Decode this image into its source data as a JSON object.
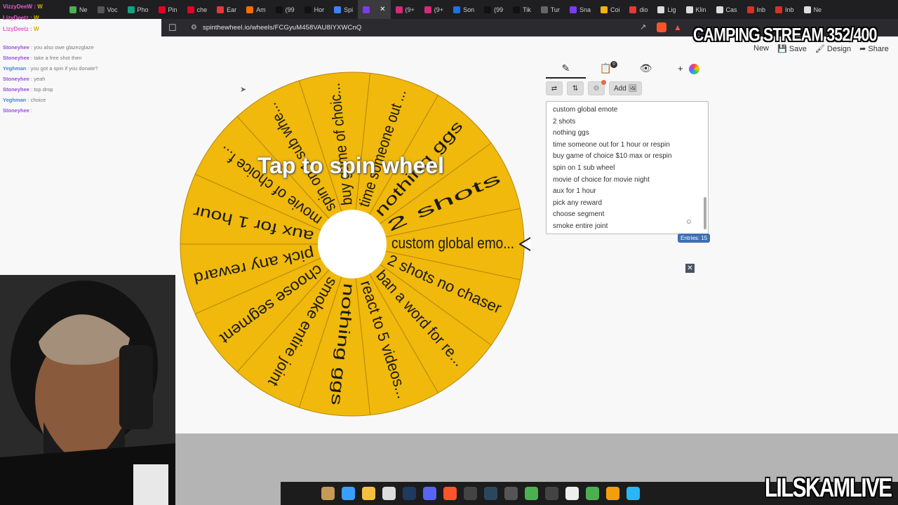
{
  "tabs": [
    {
      "label": "Ne",
      "color": "#4caf50"
    },
    {
      "label": "Voc",
      "color": "#555"
    },
    {
      "label": "Pho",
      "color": "#10a37f"
    },
    {
      "label": "Pin",
      "color": "#e60023"
    },
    {
      "label": "che",
      "color": "#e60023"
    },
    {
      "label": "Ear",
      "color": "#e53935"
    },
    {
      "label": "Am",
      "color": "#ff6d00"
    },
    {
      "label": "(99",
      "color": "#111"
    },
    {
      "label": "Hor",
      "color": "#111"
    },
    {
      "label": "Spi",
      "color": "#3b82f6"
    },
    {
      "label": "",
      "color": "#7c3aed",
      "active": true
    },
    {
      "label": "(9+",
      "color": "#d62976"
    },
    {
      "label": "(9+",
      "color": "#d62976"
    },
    {
      "label": "Son",
      "color": "#1a73e8"
    },
    {
      "label": "(99",
      "color": "#111"
    },
    {
      "label": "Tik",
      "color": "#111"
    },
    {
      "label": "Tur",
      "color": "#666"
    },
    {
      "label": "Sna",
      "color": "#7c3aed"
    },
    {
      "label": "Coi",
      "color": "#f5b400"
    },
    {
      "label": "dio",
      "color": "#e53935"
    },
    {
      "label": "Lig",
      "color": "#ddd"
    },
    {
      "label": "Klin",
      "color": "#ddd"
    },
    {
      "label": "Cas",
      "color": "#ddd"
    },
    {
      "label": "Inb",
      "color": "#d93025"
    },
    {
      "label": "Inb",
      "color": "#d93025"
    },
    {
      "label": "Ne",
      "color": "#ddd"
    }
  ],
  "address": {
    "url": "spinthewheel.io/wheels/FCGyuM458VAU8IYXWCnQ"
  },
  "chat_top": [
    {
      "user": "VizzyDeeW",
      "badge": "W"
    },
    {
      "user": "LizyDeetz",
      "badge": "W"
    },
    {
      "user": "LizyDeetz",
      "badge": "W"
    }
  ],
  "chat": [
    {
      "user": "Stoneyhee",
      "text": ": you also owe glazezglaze",
      "cls": "u1"
    },
    {
      "user": "Stoneyhee",
      "text": ": take a free shot then",
      "cls": "u1"
    },
    {
      "user": "Yeghman",
      "text": ": you got a spin if you donate?",
      "cls": "u2"
    },
    {
      "user": "Stoneyhee",
      "text": ": yeah",
      "cls": "u1"
    },
    {
      "user": "Stoneyhee",
      "text": ": top drop",
      "cls": "u1"
    },
    {
      "user": "Yeghman",
      "text": ": choice",
      "cls": "u2"
    },
    {
      "user": "Stoneyhee",
      "text": ":",
      "cls": "u1"
    }
  ],
  "overlay": {
    "camping": "CAMPING STREAM 352/400",
    "channel": "LILSKAMLIVE"
  },
  "topnav": {
    "new": "New",
    "save": "Save",
    "design": "Design",
    "share": "Share"
  },
  "wheel": {
    "spin_prompt": "Tap to spin wheel",
    "color": "#f0b90b",
    "segments": [
      "custom global emo...",
      "2 shots no chaser",
      "ban a word for re...",
      "react to 5 videos...",
      "nothing ggs",
      "smoke entire joint",
      "choose segment",
      "pick any reward",
      "aux for 1 hour",
      "movie of choice f...",
      "spin on 1 sub whe...",
      "buy game of choic...",
      "time someone out ...",
      "nothing ggs",
      "2 shots"
    ]
  },
  "panel": {
    "settings_badge": "!",
    "add_label": "Add",
    "entries": [
      "custom global emote",
      "2 shots",
      "nothing ggs",
      "time someone out for 1 hour or respin",
      "buy game of choice $10 max or respin",
      "spin on 1 sub wheel",
      "movie of choice for movie night",
      "aux for 1 hour",
      "pick any reward",
      "choose segment",
      "smoke entire joint"
    ],
    "entries_count": "Entries: 15"
  },
  "taskbar": [
    {
      "name": "cat-app",
      "color": "#c59a57"
    },
    {
      "name": "copilot",
      "color": "#3aa0ff"
    },
    {
      "name": "file-explorer",
      "color": "#f5c042"
    },
    {
      "name": "calculator",
      "color": "#ddd"
    },
    {
      "name": "photoshop",
      "color": "#1f3a5f"
    },
    {
      "name": "discord",
      "color": "#5865f2"
    },
    {
      "name": "brave",
      "color": "#fb542b"
    },
    {
      "name": "obs",
      "color": "#444"
    },
    {
      "name": "steam",
      "color": "#2a475e"
    },
    {
      "name": "streamdeck",
      "color": "#555"
    },
    {
      "name": "money",
      "color": "#4caf50"
    },
    {
      "name": "4k-downloader",
      "color": "#444"
    },
    {
      "name": "capcut",
      "color": "#eee"
    },
    {
      "name": "xbox",
      "color": "#4caf50"
    },
    {
      "name": "fl-studio",
      "color": "#f59e0b"
    },
    {
      "name": "notepad",
      "color": "#29b6f6"
    }
  ]
}
